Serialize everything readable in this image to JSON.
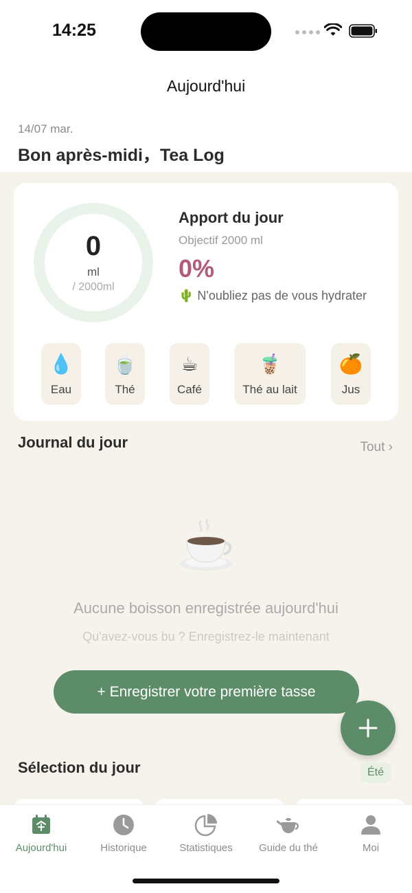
{
  "status_bar": {
    "time": "14:25"
  },
  "nav": {
    "title": "Aujourd'hui"
  },
  "header": {
    "date": "14/07 mar.",
    "greeting": "Bon après-midi，Tea Log"
  },
  "intake": {
    "current_value": "0",
    "unit": "ml",
    "goal_label": "/ 2000ml",
    "progress": 0,
    "title": "Apport du jour",
    "goal_text": "Objectif 2000 ml",
    "percent": "0%",
    "hint": "🌵 N'oubliez pas de vous hydrater",
    "drinks": [
      {
        "emoji": "💧",
        "label": "Eau"
      },
      {
        "emoji": "🍵",
        "label": "Thé"
      },
      {
        "emoji": "☕",
        "label": "Café"
      },
      {
        "emoji": "🧋",
        "label": "Thé au lait"
      },
      {
        "emoji": "🍊",
        "label": "Jus"
      }
    ]
  },
  "journal": {
    "title": "Journal du jour",
    "see_all": "Tout ›",
    "empty_title": "Aucune boisson enregistrée aujourd'hui",
    "empty_sub": "Qu'avez-vous bu ? Enregistrez-le maintenant",
    "cta": "+ Enregistrer votre première tasse"
  },
  "selection": {
    "title": "Sélection du jour",
    "season": "Été"
  },
  "tabs": [
    {
      "label": "Aujourd'hui",
      "icon": "calendar-icon",
      "active": true
    },
    {
      "label": "Historique",
      "icon": "clock-icon",
      "active": false
    },
    {
      "label": "Statistiques",
      "icon": "pie-chart-icon",
      "active": false
    },
    {
      "label": "Guide du thé",
      "icon": "teapot-icon",
      "active": false
    },
    {
      "label": "Moi",
      "icon": "user-icon",
      "active": false
    }
  ],
  "colors": {
    "accent": "#5d8c68",
    "percent": "#b35a7a",
    "background": "#f6f3ec"
  }
}
